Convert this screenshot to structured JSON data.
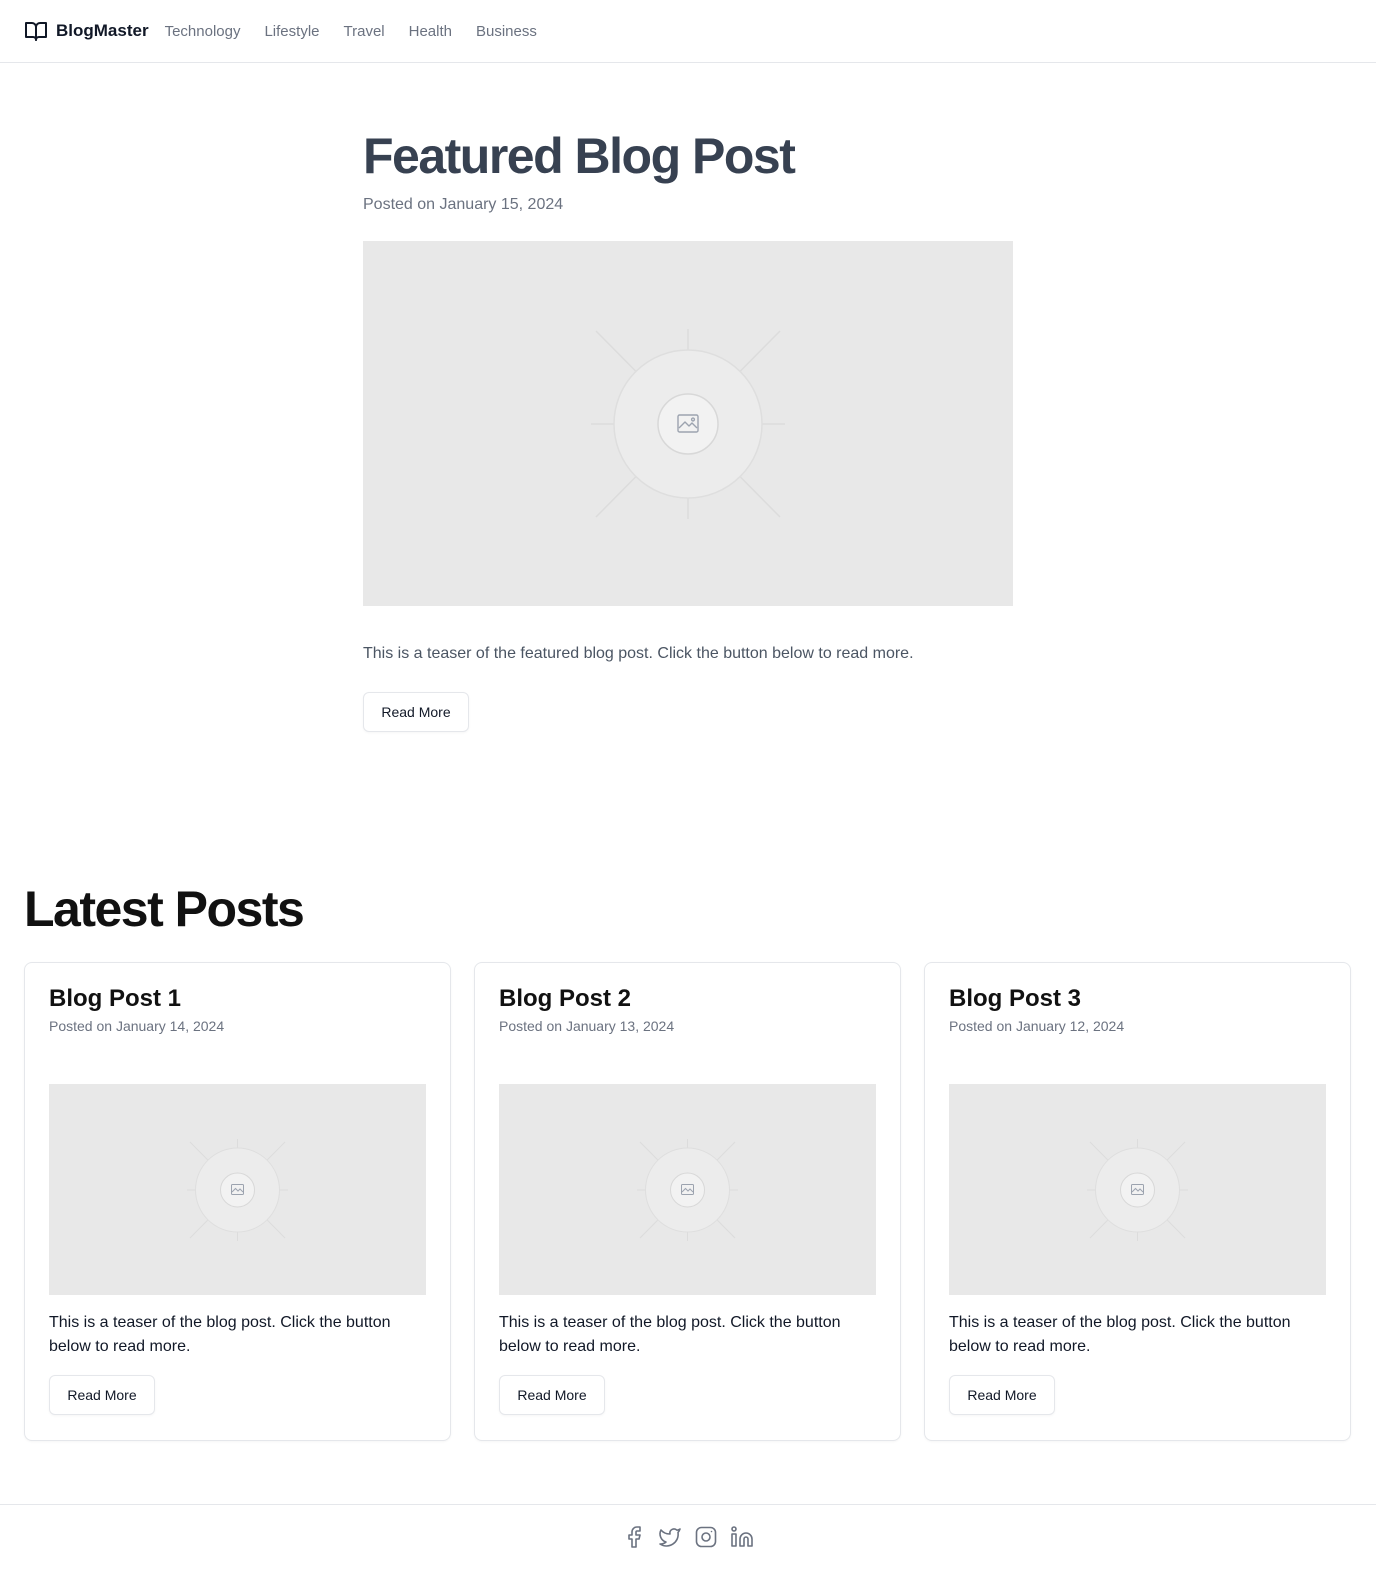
{
  "header": {
    "brand_name": "BlogMaster",
    "brand_icon": "open-book-icon",
    "nav": [
      {
        "label": "Technology"
      },
      {
        "label": "Lifestyle"
      },
      {
        "label": "Travel"
      },
      {
        "label": "Health"
      },
      {
        "label": "Business"
      }
    ]
  },
  "featured": {
    "title": "Featured Blog Post",
    "date": "Posted on January 15, 2024",
    "image_icon": "image-placeholder-icon",
    "teaser": "This is a teaser of the featured blog post. Click the button below to read more.",
    "button_label": "Read More"
  },
  "latest": {
    "heading": "Latest Posts",
    "posts": [
      {
        "title": "Blog Post 1",
        "date": "Posted on January 14, 2024",
        "teaser": "This is a teaser of the blog post. Click the button below to read more.",
        "button_label": "Read More"
      },
      {
        "title": "Blog Post 2",
        "date": "Posted on January 13, 2024",
        "teaser": "This is a teaser of the blog post. Click the button below to read more.",
        "button_label": "Read More"
      },
      {
        "title": "Blog Post 3",
        "date": "Posted on January 12, 2024",
        "teaser": "This is a teaser of the blog post. Click the button below to read more.",
        "button_label": "Read More"
      }
    ]
  },
  "footer": {
    "social": [
      "facebook-icon",
      "twitter-icon",
      "instagram-icon",
      "linkedin-icon"
    ]
  },
  "colors": {
    "text": "#111827",
    "muted": "#6b7280",
    "heading_featured": "#374151",
    "border": "#e5e7eb",
    "placeholder_bg": "#e8e8e8"
  }
}
